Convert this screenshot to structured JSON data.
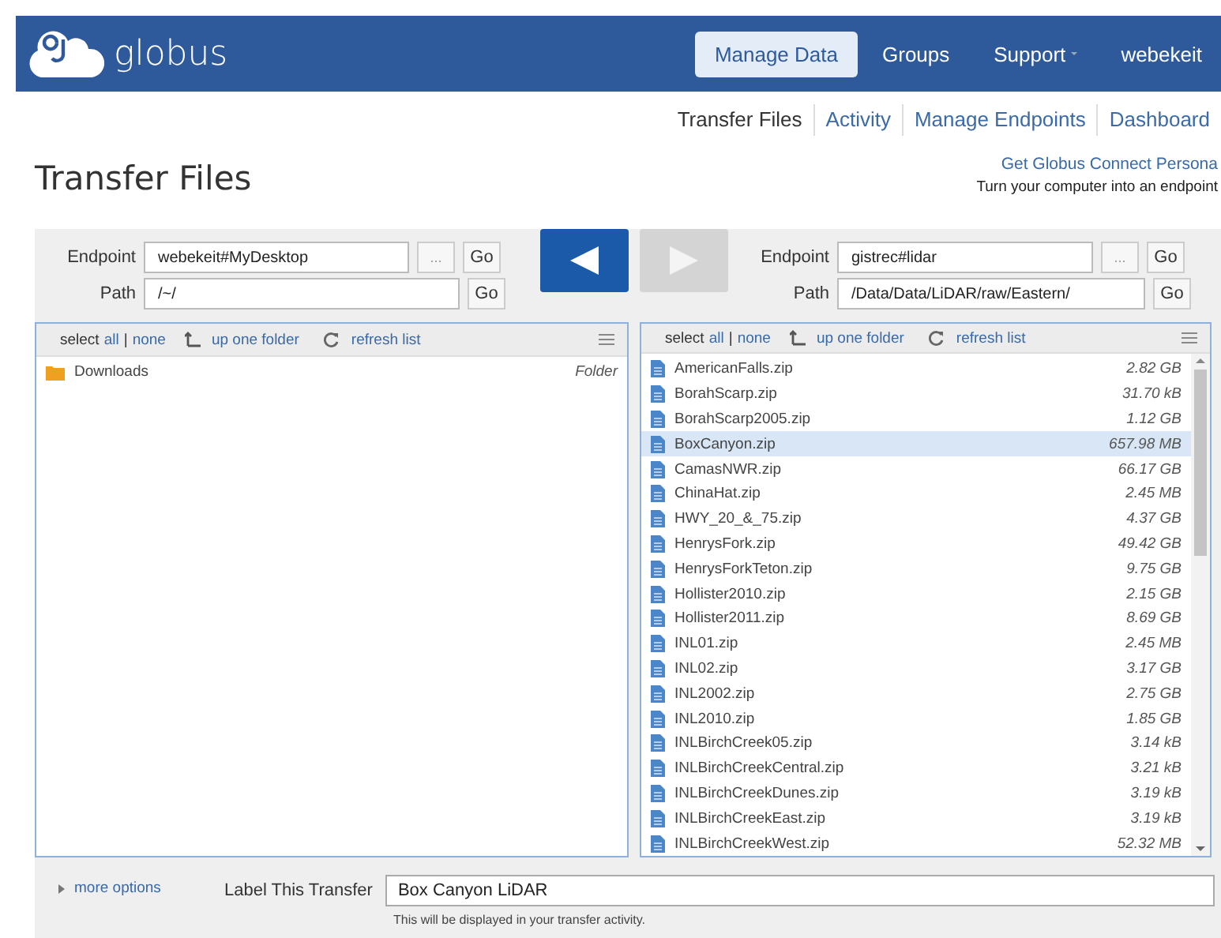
{
  "header": {
    "logo": "globus",
    "nav": [
      {
        "label": "Manage Data",
        "selected": true,
        "has_menu": false
      },
      {
        "label": "Groups",
        "selected": false,
        "has_menu": false
      },
      {
        "label": "Support",
        "selected": false,
        "has_menu": true
      },
      {
        "label": "webekeit",
        "selected": false,
        "has_menu": false
      }
    ]
  },
  "subnav": [
    {
      "label": "Transfer Files",
      "selected": true
    },
    {
      "label": "Activity",
      "selected": false
    },
    {
      "label": "Manage Endpoints",
      "selected": false
    },
    {
      "label": "Dashboard",
      "selected": false
    }
  ],
  "page_title": "Transfer Files",
  "connect": {
    "link": "Get Globus Connect Persona",
    "tagline": "Turn your computer into an endpoint"
  },
  "transfer_buttons": [
    {
      "kind": "left",
      "enabled": true
    },
    {
      "kind": "right",
      "enabled": false
    }
  ],
  "panes": [
    {
      "endpoint_label": "Endpoint",
      "endpoint": "webekeit#MyDesktop",
      "browse": "...",
      "go": "Go",
      "path_label": "Path",
      "path": "/~/",
      "path_go": "Go",
      "toolbar": {
        "select": "select",
        "all": "all",
        "separator": "|",
        "none": "none",
        "up": "up one folder",
        "refresh": "refresh list"
      },
      "scrollbar": false,
      "files": [
        {
          "name": "Downloads",
          "size": "Folder",
          "kind": "folder",
          "selected": false
        }
      ]
    },
    {
      "endpoint_label": "Endpoint",
      "endpoint": "gistrec#lidar",
      "browse": "...",
      "go": "Go",
      "path_label": "Path",
      "path": "/Data/Data/LiDAR/raw/Eastern/",
      "path_go": "Go",
      "toolbar": {
        "select": "select",
        "all": "all",
        "separator": "|",
        "none": "none",
        "up": "up one folder",
        "refresh": "refresh list"
      },
      "scrollbar": true,
      "files": [
        {
          "name": "AmericanFalls.zip",
          "size": "2.82 GB",
          "kind": "file",
          "selected": false
        },
        {
          "name": "BorahScarp.zip",
          "size": "31.70 kB",
          "kind": "file",
          "selected": false
        },
        {
          "name": "BorahScarp2005.zip",
          "size": "1.12 GB",
          "kind": "file",
          "selected": false
        },
        {
          "name": "BoxCanyon.zip",
          "size": "657.98 MB",
          "kind": "file",
          "selected": true
        },
        {
          "name": "CamasNWR.zip",
          "size": "66.17 GB",
          "kind": "file",
          "selected": false
        },
        {
          "name": "ChinaHat.zip",
          "size": "2.45 MB",
          "kind": "file",
          "selected": false
        },
        {
          "name": "HWY_20_&_75.zip",
          "size": "4.37 GB",
          "kind": "file",
          "selected": false
        },
        {
          "name": "HenrysFork.zip",
          "size": "49.42 GB",
          "kind": "file",
          "selected": false
        },
        {
          "name": "HenrysForkTeton.zip",
          "size": "9.75 GB",
          "kind": "file",
          "selected": false
        },
        {
          "name": "Hollister2010.zip",
          "size": "2.15 GB",
          "kind": "file",
          "selected": false
        },
        {
          "name": "Hollister2011.zip",
          "size": "8.69 GB",
          "kind": "file",
          "selected": false
        },
        {
          "name": "INL01.zip",
          "size": "2.45 MB",
          "kind": "file",
          "selected": false
        },
        {
          "name": "INL02.zip",
          "size": "3.17 GB",
          "kind": "file",
          "selected": false
        },
        {
          "name": "INL2002.zip",
          "size": "2.75 GB",
          "kind": "file",
          "selected": false
        },
        {
          "name": "INL2010.zip",
          "size": "1.85 GB",
          "kind": "file",
          "selected": false
        },
        {
          "name": "INLBirchCreek05.zip",
          "size": "3.14 kB",
          "kind": "file",
          "selected": false
        },
        {
          "name": "INLBirchCreekCentral.zip",
          "size": "3.21 kB",
          "kind": "file",
          "selected": false
        },
        {
          "name": "INLBirchCreekDunes.zip",
          "size": "3.19 kB",
          "kind": "file",
          "selected": false
        },
        {
          "name": "INLBirchCreekEast.zip",
          "size": "3.19 kB",
          "kind": "file",
          "selected": false
        },
        {
          "name": "INLBirchCreekWest.zip",
          "size": "52.32 MB",
          "kind": "file",
          "selected": false
        }
      ]
    }
  ],
  "options": {
    "more": "more options",
    "label_caption": "Label This Transfer",
    "label_value": "Box Canyon LiDAR",
    "hint": "This will be displayed in your transfer activity."
  }
}
